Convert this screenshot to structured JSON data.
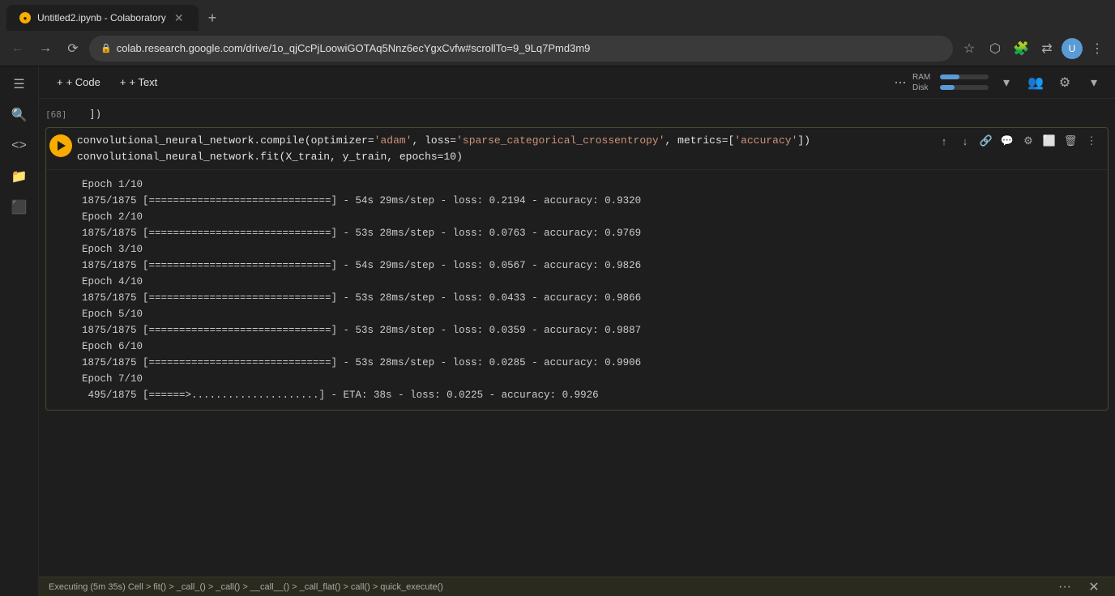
{
  "browser": {
    "tab_title": "Untitled2.ipynb - Colaboratory",
    "tab_favicon": "●",
    "url": "colab.research.google.com/drive/1o_qjCcPjLoowiGOTAq5Nnz6ecYgxCvfw#scrollTo=9_9Lq7Pmd3m9",
    "new_tab_btn": "+"
  },
  "toolbar": {
    "code_btn": "+ Code",
    "text_btn": "+ Text",
    "ram_label": "RAM",
    "disk_label": "Disk",
    "ram_percent": 40,
    "disk_percent": 30
  },
  "prev_cell": {
    "num": "[68]",
    "output": "])"
  },
  "cell": {
    "line1": "convolutional_neural_network.compile(optimizer='adam', loss='sparse_categorical_crossentropy', metrics=['accuracy'])",
    "line2": "convolutional_neural_network.fit(X_train, y_train, epochs=10)"
  },
  "output": {
    "lines": [
      "Epoch 1/10",
      "1875/1875 [==============================] - 54s 29ms/step - loss: 0.2194 - accuracy: 0.9320",
      "Epoch 2/10",
      "1875/1875 [==============================] - 53s 28ms/step - loss: 0.0763 - accuracy: 0.9769",
      "Epoch 3/10",
      "1875/1875 [==============================] - 54s 29ms/step - loss: 0.0567 - accuracy: 0.9826",
      "Epoch 4/10",
      "1875/1875 [==============================] - 53s 28ms/step - loss: 0.0433 - accuracy: 0.9866",
      "Epoch 5/10",
      "1875/1875 [==============================] - 53s 28ms/step - loss: 0.0359 - accuracy: 0.9887",
      "Epoch 6/10",
      "1875/1875 [==============================] - 53s 28ms/step - loss: 0.0285 - accuracy: 0.9906",
      "Epoch 7/10",
      " 495/1875 [======>.....................] - ETA: 38s - loss: 0.0225 - accuracy: 0.9926"
    ]
  },
  "status_bar": {
    "text": "Executing (5m 35s)  Cell > fit() > _call_() > _call() > __call__() > _call_flat() > call() > quick_execute()"
  },
  "sidebar": {
    "icons": [
      "☰",
      "🔍",
      "<>",
      "📁",
      "🖥",
      "▶",
      "🔑",
      "📊",
      "⌨"
    ]
  }
}
